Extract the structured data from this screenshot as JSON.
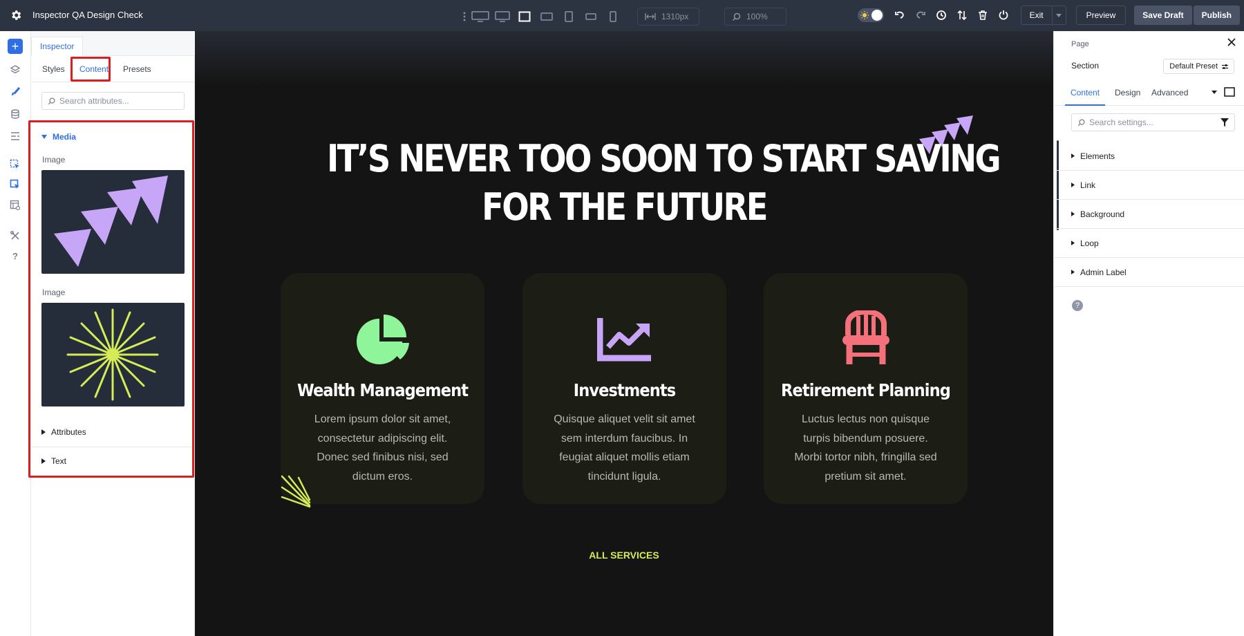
{
  "app": {
    "title": "Inspector QA Design Check"
  },
  "toolbar": {
    "width_value": "1310px",
    "zoom_value": "100%",
    "exit_label": "Exit",
    "preview_label": "Preview",
    "save_draft_label": "Save Draft",
    "publish_label": "Publish"
  },
  "left_panel": {
    "header_tab": "Inspector",
    "tabs": [
      "Styles",
      "Content",
      "Presets"
    ],
    "active_tab": "Content",
    "search_placeholder": "Search attributes...",
    "media_section": "Media",
    "image_label_1": "Image",
    "image_label_2": "Image",
    "attributes_section": "Attributes",
    "text_section": "Text"
  },
  "canvas": {
    "hero_line_1": "IT’S NEVER TOO SOON TO START SAVING",
    "hero_line_2": "FOR THE FUTURE",
    "cards": [
      {
        "title": "Wealth Management",
        "body": "Lorem ipsum dolor sit amet, consectetur adipiscing elit. Donec sed finibus nisi, sed dictum eros.",
        "icon": "pie-chart-icon"
      },
      {
        "title": "Investments",
        "body": "Quisque aliquet velit sit amet sem interdum faucibus. In feugiat aliquet mollis etiam tincidunt ligula.",
        "icon": "line-chart-icon"
      },
      {
        "title": "Retirement Planning",
        "body": "Luctus lectus non quisque turpis bibendum posuere. Morbi tortor nibh, fringilla sed pretium sit amet.",
        "icon": "chair-icon"
      }
    ],
    "cta_label": "ALL SERVICES"
  },
  "right_panel": {
    "breadcrumb": "Page",
    "element_name": "Section",
    "preset_label": "Default Preset",
    "tabs": [
      "Content",
      "Design",
      "Advanced"
    ],
    "search_placeholder": "Search settings...",
    "groups": [
      "Elements",
      "Link",
      "Background",
      "Loop",
      "Admin Label"
    ]
  },
  "colors": {
    "accent": "#2f6fe4",
    "highlight": "#d91f1f",
    "topbar": "#2c3341",
    "canvas_bg": "#141414",
    "card_bg": "#1c1d15",
    "green": "#8ff59a",
    "purple": "#c7a6f7",
    "coral": "#f4707a",
    "yellow": "#d6ec57"
  }
}
